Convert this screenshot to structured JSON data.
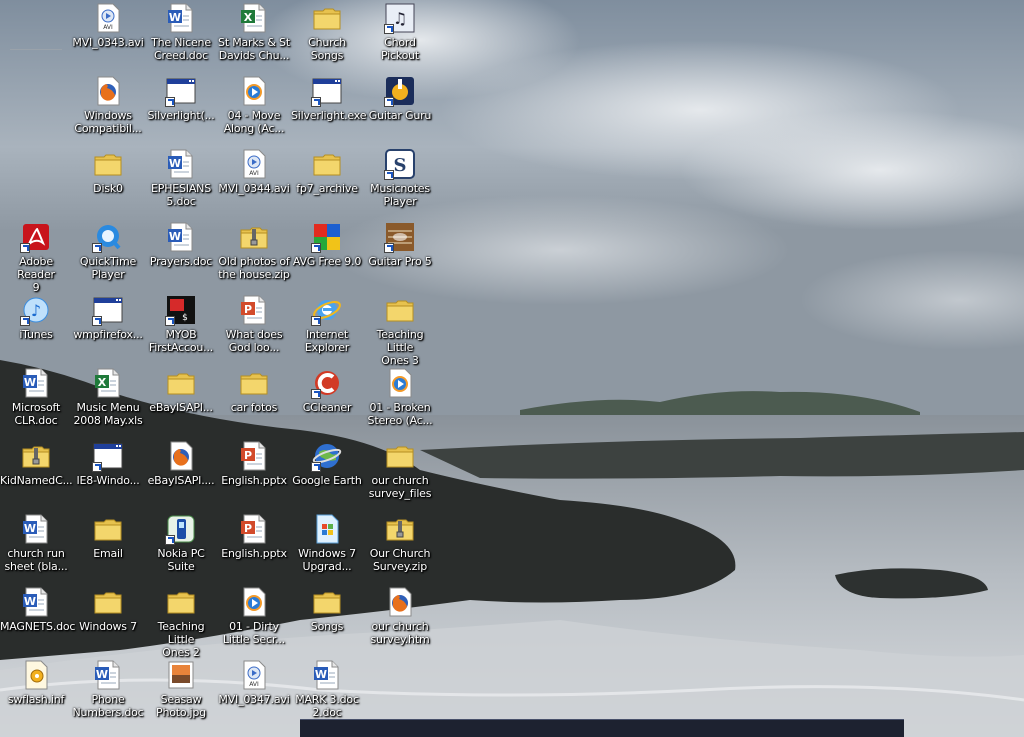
{
  "desktop": {
    "icons": [
      {
        "label": "MVI_0343.avi",
        "icon": "avi-file-icon"
      },
      {
        "label": "The Nicene\nCreed.doc",
        "icon": "word-doc-icon"
      },
      {
        "label": "St Marks & St\nDavids Chu...",
        "icon": "excel-file-icon"
      },
      {
        "label": "Church Songs",
        "icon": "folder-icon"
      },
      {
        "label": "Chord Pickout",
        "icon": "chord-pickout-icon"
      },
      {
        "label": "Windows\nCompatibil...",
        "icon": "firefox-html-icon"
      },
      {
        "label": "Silverlight(...",
        "icon": "window-app-icon"
      },
      {
        "label": "04 - Move\nAlong (Ac...",
        "icon": "media-file-icon"
      },
      {
        "label": "Silverlight.exe",
        "icon": "window-app-icon"
      },
      {
        "label": "Guitar Guru",
        "icon": "guitar-guru-icon"
      },
      {
        "label": "Disk0",
        "icon": "folder-icon"
      },
      {
        "label": "EPHESIANS\n5.doc",
        "icon": "word-doc-icon"
      },
      {
        "label": "MVI_0344.avi",
        "icon": "avi-file-icon"
      },
      {
        "label": "fp7_archive",
        "icon": "folder-icon"
      },
      {
        "label": "Musicnotes\nPlayer",
        "icon": "musicnotes-icon"
      },
      {
        "label": "Adobe Reader\n9",
        "icon": "adobe-reader-icon"
      },
      {
        "label": "QuickTime\nPlayer",
        "icon": "quicktime-icon"
      },
      {
        "label": "Prayers.doc",
        "icon": "word-doc-icon"
      },
      {
        "label": "Old photos of\nthe house.zip",
        "icon": "zip-folder-icon"
      },
      {
        "label": "AVG Free 9.0",
        "icon": "avg-icon"
      },
      {
        "label": "Guitar Pro 5",
        "icon": "guitar-pro-icon"
      },
      {
        "label": "iTunes",
        "icon": "itunes-icon"
      },
      {
        "label": "wmpfirefox...",
        "icon": "window-app-icon"
      },
      {
        "label": "MYOB\nFirstAccou...",
        "icon": "myob-icon"
      },
      {
        "label": "What does\nGod loo...",
        "icon": "powerpoint-icon"
      },
      {
        "label": "Internet\nExplorer",
        "icon": "internet-explorer-icon"
      },
      {
        "label": "Teaching Little\nOnes 3",
        "icon": "folder-icon"
      },
      {
        "label": "Microsoft\nCLR.doc",
        "icon": "word-doc-icon"
      },
      {
        "label": "Music Menu\n2008 May.xls",
        "icon": "excel-file-icon"
      },
      {
        "label": "eBayISAPI...",
        "icon": "folder-icon"
      },
      {
        "label": "car fotos",
        "icon": "folder-icon"
      },
      {
        "label": "CCleaner",
        "icon": "ccleaner-icon"
      },
      {
        "label": "01 - Broken\nStereo (Ac...",
        "icon": "media-file-icon"
      },
      {
        "label": "KidNamedC...",
        "icon": "zip-folder-icon"
      },
      {
        "label": "IE8-Windo...",
        "icon": "window-app-icon"
      },
      {
        "label": "eBayISAPI....",
        "icon": "firefox-html-icon"
      },
      {
        "label": "English.pptx",
        "icon": "powerpoint-icon"
      },
      {
        "label": "Google Earth",
        "icon": "google-earth-icon"
      },
      {
        "label": "our church\nsurvey_files",
        "icon": "folder-icon"
      },
      {
        "label": "church run\nsheet (bla...",
        "icon": "word-doc-icon"
      },
      {
        "label": "Email",
        "icon": "folder-icon"
      },
      {
        "label": "Nokia PC Suite",
        "icon": "nokia-pc-suite-icon"
      },
      {
        "label": "English.pptx",
        "icon": "powerpoint-icon"
      },
      {
        "label": "Windows 7\nUpgrad...",
        "icon": "windows7-upgrade-icon"
      },
      {
        "label": "Our Church\nSurvey.zip",
        "icon": "zip-folder-icon"
      },
      {
        "label": "MAGNETS.doc",
        "icon": "word-doc-icon"
      },
      {
        "label": "Windows 7",
        "icon": "folder-icon"
      },
      {
        "label": "Teaching Little\nOnes 2",
        "icon": "folder-icon"
      },
      {
        "label": "01 - Dirty\nLittle Secr...",
        "icon": "media-file-icon"
      },
      {
        "label": "Songs",
        "icon": "folder-icon"
      },
      {
        "label": "our church\nsurvey.htm",
        "icon": "firefox-html-icon"
      },
      {
        "label": "swflash.inf",
        "icon": "inf-file-icon"
      },
      {
        "label": "Phone\nNumbers.doc",
        "icon": "word-doc-icon"
      },
      {
        "label": "Seasaw\nPhoto.jpg",
        "icon": "jpg-image-icon"
      },
      {
        "label": "MVI_0347.avi",
        "icon": "avi-file-icon"
      },
      {
        "label": "MARK 3.doc\n2.doc",
        "icon": "word-doc-icon"
      }
    ],
    "colors": {
      "folder": "#f3d66c",
      "word_blue": "#2a5cb8",
      "excel_green": "#1f7a3a",
      "pptx_red": "#d24b2b",
      "label_text": "#ffffff"
    }
  }
}
